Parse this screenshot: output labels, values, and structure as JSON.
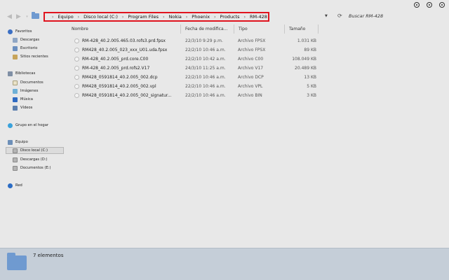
{
  "address": {
    "crumbs": [
      "Equipo",
      "Disco local (C:)",
      "Program Files",
      "Nokia",
      "Phoenix",
      "Products",
      "RM-428"
    ],
    "search_placeholder": "Buscar RM-428"
  },
  "nav": {
    "favorites": {
      "label": "Favoritos",
      "items": [
        "Descargas",
        "Escritorio",
        "Sitios recientes"
      ]
    },
    "libraries": {
      "label": "Bibliotecas",
      "items": [
        "Documentos",
        "Imágenes",
        "Música",
        "Vídeos"
      ]
    },
    "homegroup": "Grupo en el hogar",
    "computer": {
      "label": "Equipo",
      "items": [
        "Disco local (C:)",
        "Descargas (D:)",
        "Documentos (E:)"
      ],
      "selected": "Disco local (C:)"
    },
    "network": "Red"
  },
  "columns": [
    "Nombre",
    "Fecha de modifica...",
    "Tipo",
    "Tamaño"
  ],
  "files": [
    {
      "name": "RM-428_40.2.005.465.03.rofs3.prd.fpsx",
      "date": "22/3/10 9:29 p.m.",
      "type": "Archivo FPSX",
      "size": "1.031 KB"
    },
    {
      "name": "RM428_40.2.005_023_xxx_U01.uda.fpsx",
      "date": "22/2/10 10:46 a.m.",
      "type": "Archivo FPSX",
      "size": "89 KB"
    },
    {
      "name": "RM-428_40.2.005_prd.core.C00",
      "date": "22/2/10 10:42 a.m.",
      "type": "Archivo C00",
      "size": "108.049 KB"
    },
    {
      "name": "RM-428_40.2.005_prd.rofs2.V17",
      "date": "24/3/10 11:25 a.m.",
      "type": "Archivo V17",
      "size": "20.489 KB"
    },
    {
      "name": "RM428_0591814_40.2.005_002.dcp",
      "date": "22/2/10 10:46 a.m.",
      "type": "Archivo DCP",
      "size": "13 KB"
    },
    {
      "name": "RM428_0591814_40.2.005_002.vpl",
      "date": "22/2/10 10:46 a.m.",
      "type": "Archivo VPL",
      "size": "5 KB"
    },
    {
      "name": "RM428_0591814_40.2.005_002_signatur...",
      "date": "22/2/10 10:46 a.m.",
      "type": "Archivo BIN",
      "size": "3 KB"
    }
  ],
  "status": {
    "count": "7 elementos"
  },
  "colors": {
    "highlight_border": "#e0141e",
    "details_bg": "#c5ced8",
    "folder": "#6f9ad0"
  }
}
